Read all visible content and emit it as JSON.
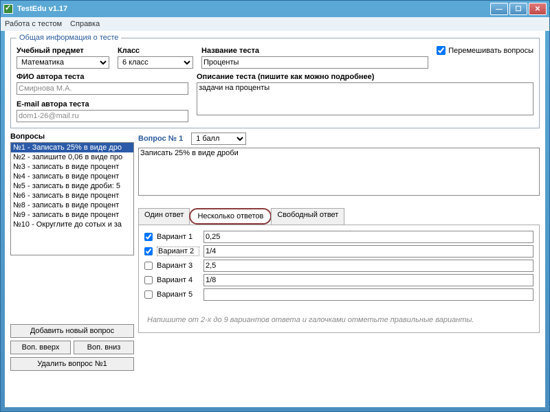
{
  "window": {
    "title": "TestEdu v1.17"
  },
  "menu": {
    "item1": "Работа с тестом",
    "item2": "Справка"
  },
  "general": {
    "legend": "Общая информация о тесте",
    "subject_label": "Учебный предмет",
    "subject_value": "Математика",
    "class_label": "Класс",
    "class_value": "6 класс",
    "title_label": "Название теста",
    "title_value": "Проценты",
    "shuffle_label": "Перемешивать вопросы",
    "author_label": "ФИО автора теста",
    "author_value": "Смирнова М.А.",
    "desc_label": "Описание теста (пишите как можно подробнее)",
    "desc_value": "задачи на проценты",
    "email_label": "E-mail автора теста",
    "email_value": "dom1-26@mail.ru"
  },
  "questions": {
    "header": "Вопросы",
    "items": [
      "№1 - Записать 25% в виде дро",
      "№2 - запишите 0,06 в виде про",
      "№3 - записать в виде процент",
      "№4 - записать в виде процент",
      "№5 - записать в виде дроби: 5",
      "№6 - записать в виде процент",
      "№8 - записать в виде процент",
      "№9 - записать в виде процент",
      "№10 - Округлите до сотых и за"
    ],
    "btn_add": "Добавить новый вопрос",
    "btn_up": "Воп. вверх",
    "btn_down": "Воп. вниз",
    "btn_del": "Удалить вопрос №1"
  },
  "question": {
    "title": "Вопрос № 1",
    "points_value": "1 балл",
    "text": "Записать 25% в виде дроби",
    "tab1": "Один ответ",
    "tab2": "Несколько ответов",
    "tab3": "Свободный ответ",
    "variants": [
      {
        "label": "Вариант 1",
        "value": "0,25",
        "checked": true
      },
      {
        "label": "Вариант 2",
        "value": "1/4",
        "checked": true
      },
      {
        "label": "Вариант 3",
        "value": "2,5",
        "checked": false
      },
      {
        "label": "Вариант 4",
        "value": "1/8",
        "checked": false
      },
      {
        "label": "Вариант 5",
        "value": "",
        "checked": false
      }
    ],
    "hint": "Напишите от 2-х до 9 вариантов ответа и галочками отметьте правильные варианты."
  }
}
